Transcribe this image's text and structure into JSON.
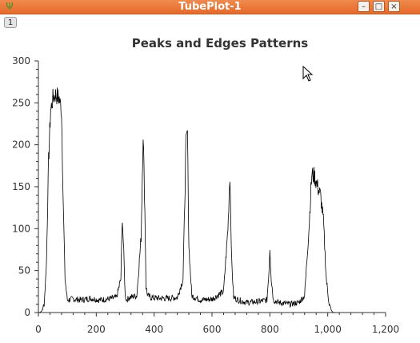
{
  "window": {
    "title": "TubePlot-1",
    "app_icon": "antenna-icon",
    "buttons": [
      "minimize-icon",
      "maximize-icon",
      "close-icon"
    ]
  },
  "page_tab": {
    "label": "1"
  },
  "chart_data": {
    "type": "line",
    "title": "Peaks and Edges Patterns",
    "xlabel": "",
    "ylabel": "",
    "xlim": [
      0,
      1200
    ],
    "ylim": [
      0,
      300
    ],
    "xticks": [
      0,
      200,
      400,
      600,
      800,
      1000,
      1200
    ],
    "xtick_labels": [
      "0",
      "200",
      "400",
      "600",
      "800",
      "1,000",
      "1,200"
    ],
    "yticks": [
      0,
      50,
      100,
      150,
      200,
      250,
      300
    ],
    "ytick_labels": [
      "0",
      "50",
      "100",
      "150",
      "200",
      "250",
      "300"
    ],
    "grid": false,
    "line_color": "#000000",
    "series": [
      {
        "x": [
          0,
          5,
          12,
          20,
          28,
          35,
          42,
          50,
          58,
          65,
          72,
          80,
          86,
          92,
          100,
          120,
          150,
          180,
          210,
          240,
          270,
          285,
          290,
          295,
          300,
          305,
          315,
          340,
          355,
          362,
          368,
          372,
          378,
          390,
          420,
          450,
          480,
          500,
          510,
          515,
          520,
          530,
          560,
          600,
          640,
          655,
          662,
          668,
          675,
          690,
          720,
          760,
          790,
          797,
          800,
          805,
          812,
          830,
          870,
          900,
          920,
          935,
          945,
          955,
          965,
          975,
          985,
          995,
          1005,
          1012,
          1018,
          1025
        ],
        "y": [
          0,
          0,
          2,
          10,
          60,
          180,
          240,
          255,
          260,
          258,
          255,
          240,
          130,
          40,
          15,
          16,
          15,
          17,
          15,
          16,
          18,
          40,
          115,
          70,
          20,
          15,
          18,
          20,
          90,
          215,
          120,
          30,
          20,
          18,
          17,
          17,
          18,
          40,
          200,
          215,
          80,
          20,
          15,
          16,
          25,
          100,
          165,
          60,
          18,
          15,
          12,
          13,
          15,
          50,
          78,
          40,
          15,
          12,
          10,
          12,
          20,
          100,
          165,
          162,
          150,
          140,
          110,
          40,
          10,
          3,
          0,
          0
        ]
      }
    ]
  }
}
